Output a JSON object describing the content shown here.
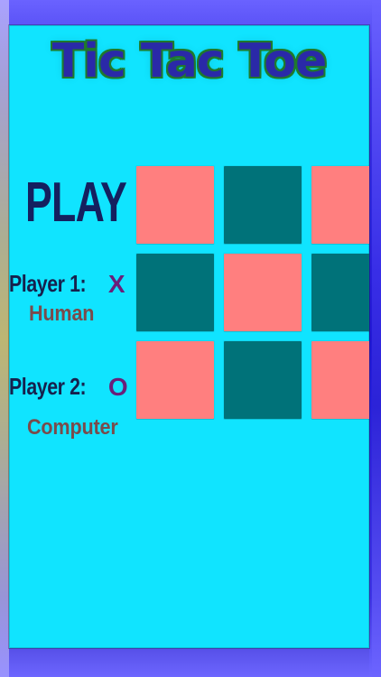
{
  "app": {
    "title": "Tic Tac Toe"
  },
  "left_panel": {
    "play_label": "PLAY",
    "player1": {
      "label": "Player 1:",
      "mark": "X",
      "type": "Human"
    },
    "player2": {
      "label": "Player 2:",
      "mark": "O",
      "type": "Computer"
    }
  },
  "board": {
    "rows": 3,
    "cols": 3,
    "cells": [
      {
        "row": 0,
        "col": 0,
        "fill": "#ff7f7f"
      },
      {
        "row": 0,
        "col": 1,
        "fill": "#007279"
      },
      {
        "row": 0,
        "col": 2,
        "fill": "#ff7f7f"
      },
      {
        "row": 1,
        "col": 0,
        "fill": "#007279"
      },
      {
        "row": 1,
        "col": 1,
        "fill": "#ff7f7f"
      },
      {
        "row": 1,
        "col": 2,
        "fill": "#007279"
      },
      {
        "row": 2,
        "col": 0,
        "fill": "#ff7f7f"
      },
      {
        "row": 2,
        "col": 1,
        "fill": "#007279"
      },
      {
        "row": 2,
        "col": 2,
        "fill": "#ff7f7f"
      }
    ]
  },
  "colors": {
    "background": "#2c23d7",
    "panel": "#10e4ff",
    "title_fill": "#2a29a8",
    "title_outline": "#1f7a2c",
    "text_dark": "#16214d",
    "text_muted": "#7a4b4b",
    "mark": "#6a1f7a"
  }
}
